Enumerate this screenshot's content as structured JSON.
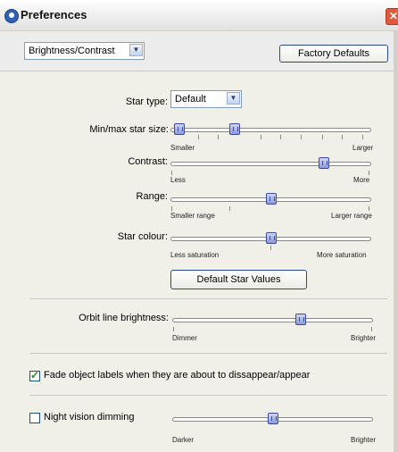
{
  "window": {
    "title": "Preferences",
    "close": "✕"
  },
  "topbar": {
    "category": "Brightness/Contrast",
    "factory_defaults": "Factory Defaults"
  },
  "star_type": {
    "label": "Star type:",
    "value": "Default"
  },
  "sliders": {
    "star_size": {
      "label": "Min/max star size:",
      "min": "Smaller",
      "max": "Larger",
      "low_fraction": 0.02,
      "high_fraction": 0.31
    },
    "contrast": {
      "label": "Contrast:",
      "min": "Less",
      "max": "More",
      "fraction": 0.78
    },
    "range": {
      "label": "Range:",
      "min": "Smaller range",
      "max": "Larger range",
      "fraction": 0.5
    },
    "star_colour": {
      "label": "Star colour:",
      "min": "Less saturation",
      "max": "More saturation",
      "fraction": 0.5
    },
    "orbit": {
      "label": "Orbit line brightness:",
      "min": "Dimmer",
      "max": "Brighter",
      "fraction": 0.65
    },
    "night": {
      "min": "Darker",
      "max": "Brighter",
      "fraction": 0.5
    }
  },
  "default_star_values": "Default Star Values",
  "fade_labels": {
    "label": "Fade object labels when they are about to dissappear/appear",
    "checked": true
  },
  "night_vision": {
    "label": "Night vision dimming",
    "checked": false
  }
}
